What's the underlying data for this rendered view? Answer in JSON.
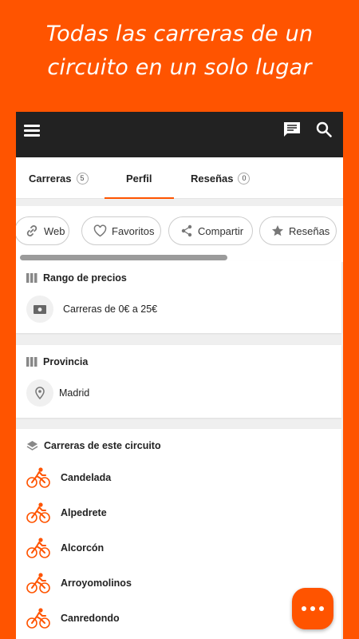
{
  "promo": {
    "line1": "Todas las carreras de un",
    "line2": "circuito en un solo lugar"
  },
  "appbar": {
    "menu_icon": "hamburger-menu-icon",
    "chat_icon": "chat-icon",
    "search_icon": "search-icon"
  },
  "tabs": [
    {
      "label": "Carreras",
      "count": "5"
    },
    {
      "label": "Perfil",
      "count": ""
    },
    {
      "label": "Reseñas",
      "count": "0"
    }
  ],
  "active_tab": "Perfil",
  "chips": [
    {
      "label": "Web",
      "icon": "link-icon"
    },
    {
      "label": "Favoritos",
      "icon": "heart-icon"
    },
    {
      "label": "Compartir",
      "icon": "share-icon"
    },
    {
      "label": "Reseñas",
      "icon": "star-icon"
    }
  ],
  "price_card": {
    "title": "Rango de precios",
    "text": "Carreras de 0€ a 25€"
  },
  "province_card": {
    "title": "Provincia",
    "text": "Madrid"
  },
  "races_card": {
    "title": "Carreras de este circuito",
    "items": [
      "Candelada",
      "Alpedrete",
      "Alcorcón",
      "Arroyomolinos",
      "Canredondo"
    ]
  },
  "colors": {
    "accent": "#ff5400",
    "appbar": "#222222",
    "background": "#efefef"
  }
}
